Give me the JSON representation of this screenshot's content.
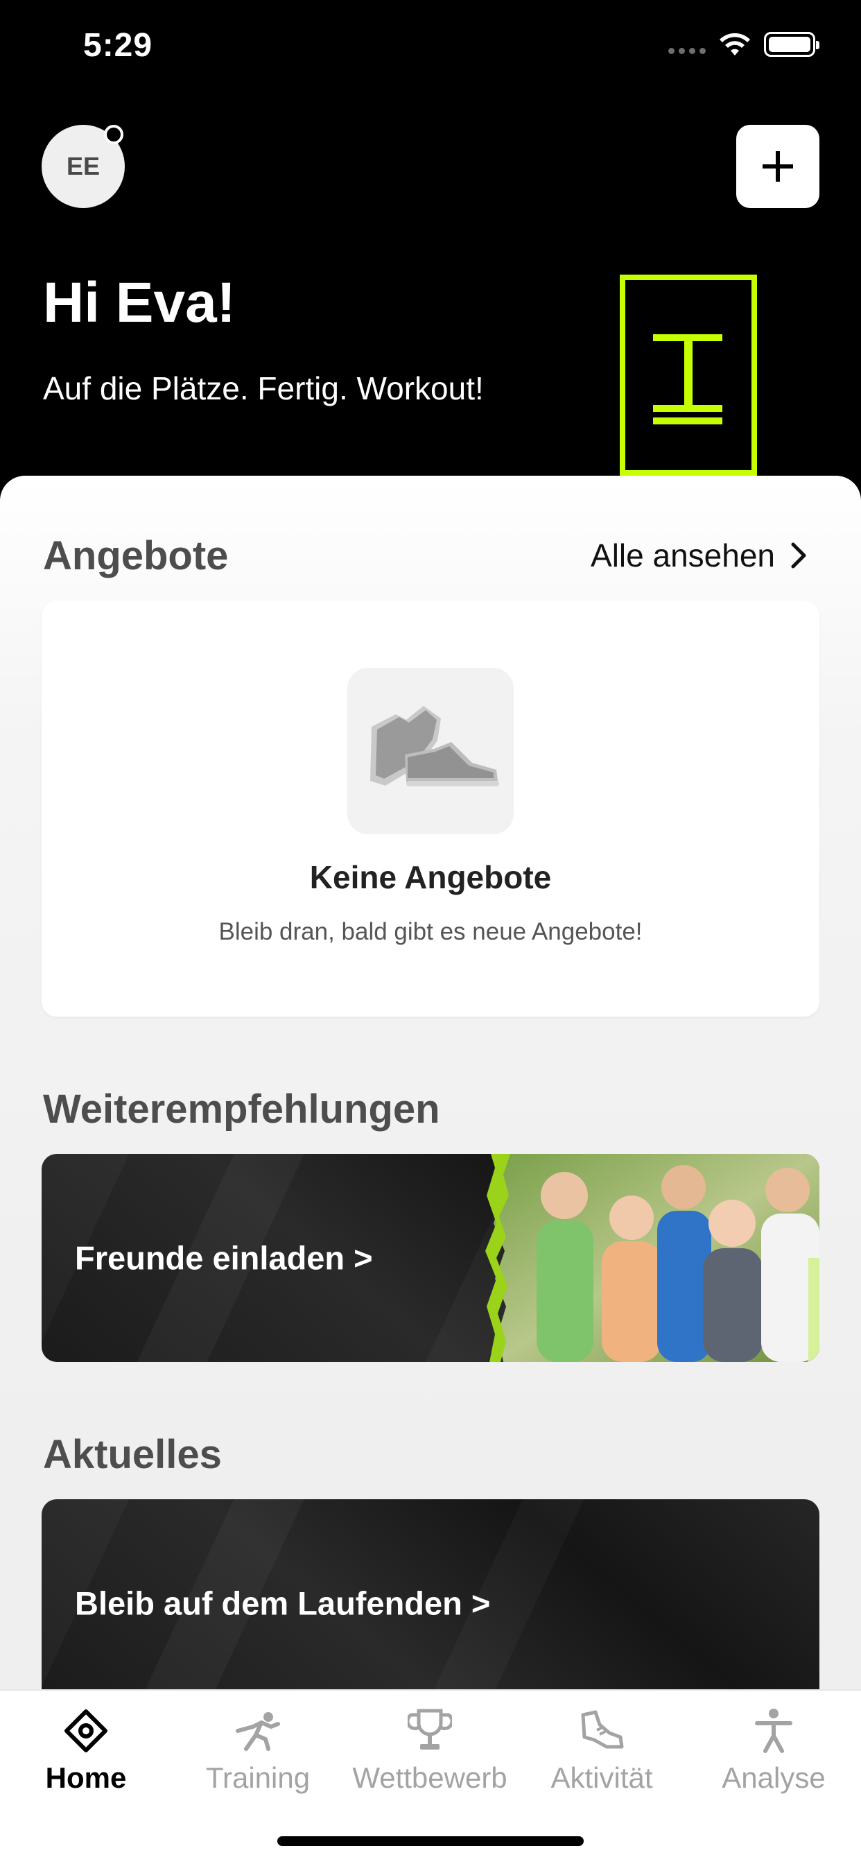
{
  "status_bar": {
    "time": "5:29"
  },
  "header": {
    "avatar_initials": "EE",
    "greeting": "Hi Eva!",
    "tagline": "Auf die Plätze. Fertig. Workout!",
    "accent_color": "#c6ff00"
  },
  "offers": {
    "title": "Angebote",
    "see_all_label": "Alle ansehen",
    "empty_title": "Keine Angebote",
    "empty_subtitle": "Bleib dran, bald gibt es neue Angebote!"
  },
  "referrals": {
    "title": "Weiterempfehlungen",
    "banner_label": "Freunde einladen >"
  },
  "news": {
    "title": "Aktuelles",
    "banner_label": "Bleib auf dem Laufenden >"
  },
  "tabs": [
    {
      "label": "Home",
      "icon": "home-icon",
      "active": true
    },
    {
      "label": "Training",
      "icon": "training-icon",
      "active": false
    },
    {
      "label": "Wettbewerb",
      "icon": "trophy-icon",
      "active": false
    },
    {
      "label": "Aktivität",
      "icon": "activity-shoe-icon",
      "active": false
    },
    {
      "label": "Analyse",
      "icon": "person-icon",
      "active": false
    }
  ]
}
